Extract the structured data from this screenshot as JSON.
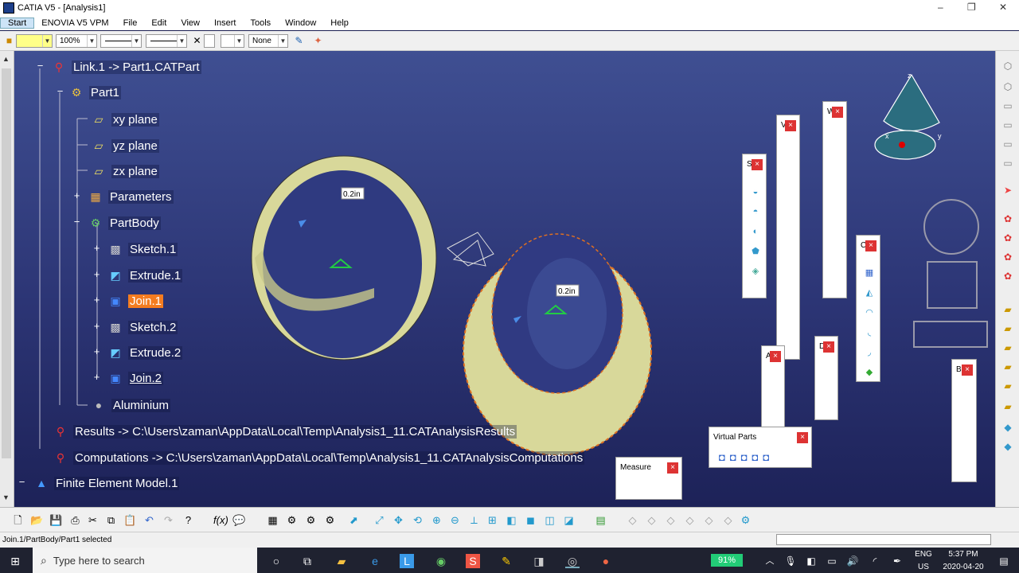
{
  "window": {
    "title": "CATIA V5 - [Analysis1]",
    "minimize_glyph": "–",
    "restore_glyph": "❐",
    "close_glyph": "✕"
  },
  "menu": [
    "Start",
    "ENOVIA V5 VPM",
    "File",
    "Edit",
    "View",
    "Insert",
    "Tools",
    "Window",
    "Help"
  ],
  "toolbar1": {
    "zoom_value": "100%",
    "render_value": "None"
  },
  "tree": {
    "link": "Link.1 -> Part1.CATPart",
    "part": "Part1",
    "xy": "xy plane",
    "yz": "yz plane",
    "zx": "zx plane",
    "parameters": "Parameters",
    "partbody": "PartBody",
    "sketch1": "Sketch.1",
    "extrude1": "Extrude.1",
    "join1": "Join.1",
    "sketch2": "Sketch.2",
    "extrude2": "Extrude.2",
    "join2": "Join.2",
    "material": "Aluminium",
    "results": "Results -> C:\\Users\\zaman\\AppData\\Local\\Temp\\Analysis1_11.CATAnalysisResults",
    "computations": "Computations -> C:\\Users\\zaman\\AppData\\Local\\Temp\\Analysis1_11.CATAnalysisComputations",
    "fem": "Finite Element Model.1"
  },
  "viewport": {
    "dim_label_1": "0.2in",
    "dim_label_2": "0.2in",
    "compass_x": "x",
    "compass_y": "y",
    "compass_z": "z"
  },
  "panels": {
    "virtual_parts": "Virtual Parts",
    "measure": "Measure",
    "s_tag": "S",
    "v_tag": "V",
    "w_tag": "W",
    "c_tag": "C",
    "d_tag": "D",
    "a_tag": "A",
    "b_tag": "B",
    "close": "×"
  },
  "status": {
    "message": "Join.1/PartBody/Part1 selected"
  },
  "taskbar": {
    "search_placeholder": "Type here to search",
    "battery": "91%",
    "lang": "ENG",
    "region": "US",
    "time": "5:37 PM",
    "date": "2020-04-20"
  },
  "colors": {
    "accent_highlight": "#f47c20",
    "cylinder": "#dcdca0",
    "viewport_top": "#3f4f92",
    "viewport_bottom": "#1d2258"
  }
}
